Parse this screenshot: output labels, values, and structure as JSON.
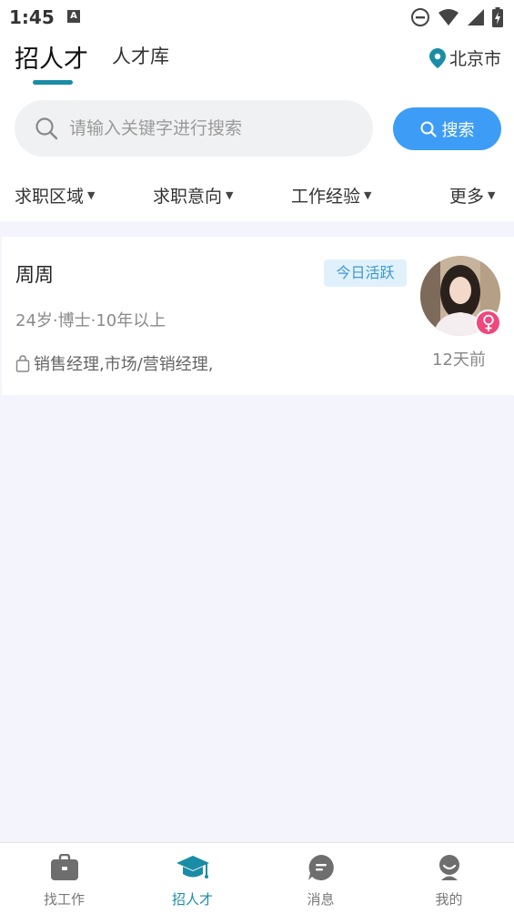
{
  "status_bar": {
    "time": "1:45",
    "notification_letter": "A"
  },
  "tabs": {
    "active": "招人才",
    "other": "人才库"
  },
  "location": {
    "city": "北京市"
  },
  "search": {
    "placeholder": "请输入关键字进行搜索",
    "button_label": "搜索"
  },
  "filters": [
    {
      "label": "求职区域"
    },
    {
      "label": "求职意向"
    },
    {
      "label": "工作经验"
    },
    {
      "label": "更多"
    }
  ],
  "candidates": [
    {
      "name": "周周",
      "badge": "今日活跃",
      "info": "24岁·博士·10年以上",
      "jobs": "销售经理,市场/营销经理,",
      "time_ago": "12天前",
      "gender": "female"
    }
  ],
  "bottom_nav": [
    {
      "label": "找工作",
      "icon": "briefcase-icon"
    },
    {
      "label": "招人才",
      "icon": "graduation-cap-icon",
      "active": true
    },
    {
      "label": "消息",
      "icon": "message-icon"
    },
    {
      "label": "我的",
      "icon": "profile-icon"
    }
  ],
  "colors": {
    "accent": "#1a8ca6",
    "search_button": "#3d9cf5",
    "badge_bg": "#e1f1fb",
    "female": "#f0477c",
    "page_bg": "#f4f5fc"
  }
}
